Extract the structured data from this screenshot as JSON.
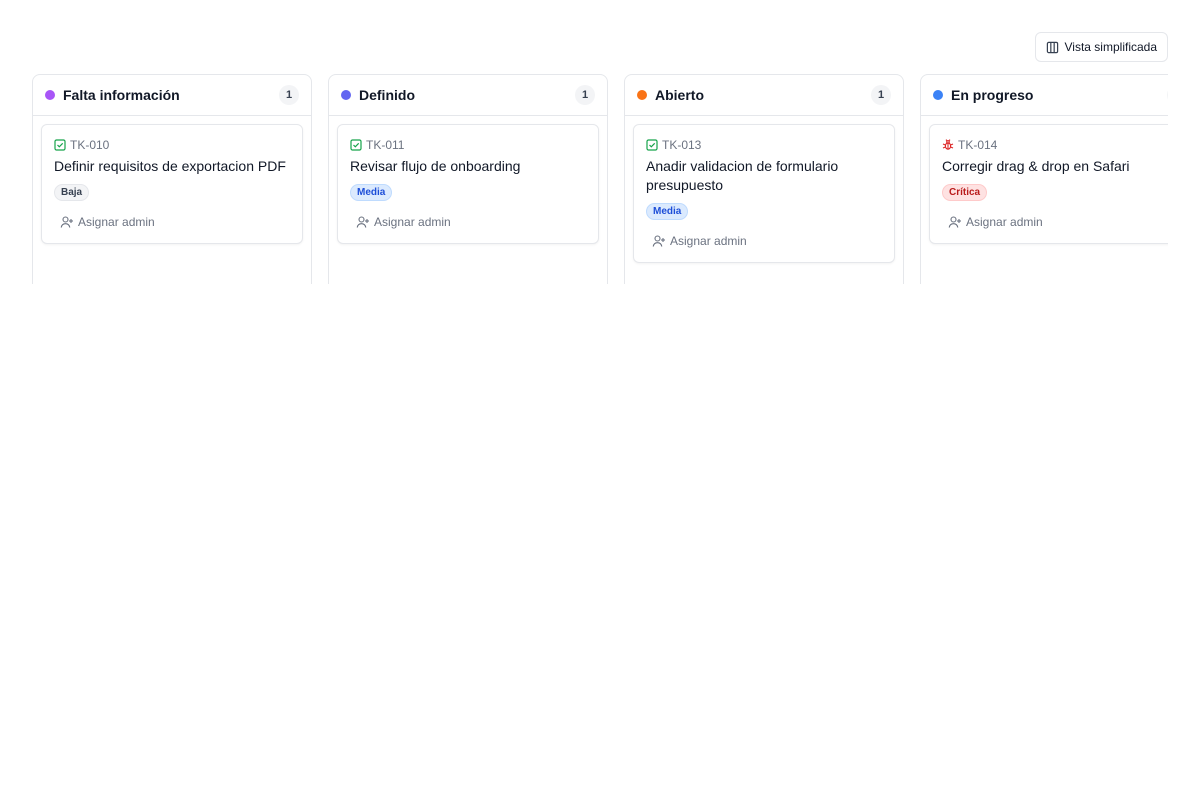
{
  "toolbar": {
    "view_toggle_label": "Vista simplificada",
    "view_toggle_icon": "columns-icon"
  },
  "columns": [
    {
      "title": "Falta información",
      "count": "1",
      "color": "#a855f7",
      "cards": [
        {
          "id": "TK-010",
          "type_icon": "task-check-icon",
          "type_color": "#16a34a",
          "title": "Definir requisitos de exportacion PDF",
          "priority": "Baja",
          "priority_bg": "#f3f4f6",
          "priority_fg": "#374151",
          "priority_border": "#e5e7eb",
          "assign_label": "Asignar admin"
        }
      ]
    },
    {
      "title": "Definido",
      "count": "1",
      "color": "#6366f1",
      "cards": [
        {
          "id": "TK-011",
          "type_icon": "task-check-icon",
          "type_color": "#16a34a",
          "title": "Revisar flujo de onboarding",
          "priority": "Media",
          "priority_bg": "#dbeafe",
          "priority_fg": "#1d4ed8",
          "priority_border": "#bfdbfe",
          "assign_label": "Asignar admin"
        }
      ]
    },
    {
      "title": "Abierto",
      "count": "1",
      "color": "#f97316",
      "cards": [
        {
          "id": "TK-013",
          "type_icon": "task-check-icon",
          "type_color": "#16a34a",
          "title": "Anadir validacion de formulario presupuesto",
          "priority": "Media",
          "priority_bg": "#dbeafe",
          "priority_fg": "#1d4ed8",
          "priority_border": "#bfdbfe",
          "assign_label": "Asignar admin"
        }
      ]
    },
    {
      "title": "En progreso",
      "count": "1",
      "color": "#3b82f6",
      "cards": [
        {
          "id": "TK-014",
          "type_icon": "bug-icon",
          "type_color": "#dc2626",
          "title": "Corregir drag & drop en Safari",
          "priority": "Crítica",
          "priority_bg": "#fee2e2",
          "priority_fg": "#b91c1c",
          "priority_border": "#fecaca",
          "assign_label": "Asignar admin"
        }
      ]
    }
  ]
}
